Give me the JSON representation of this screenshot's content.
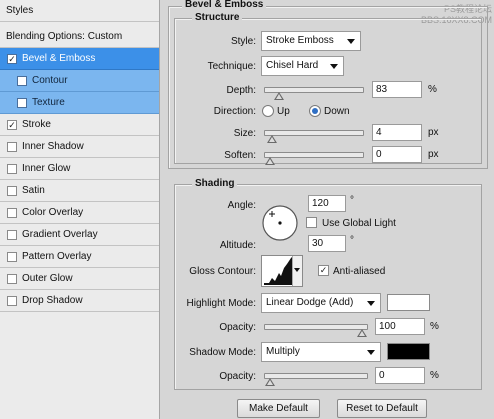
{
  "left_panel": {
    "header": "Styles",
    "blending": "Blending Options: Custom",
    "items": [
      {
        "label": "Bevel & Emboss",
        "checked": true
      },
      {
        "label": "Contour",
        "checked": false
      },
      {
        "label": "Texture",
        "checked": false
      },
      {
        "label": "Stroke",
        "checked": true
      },
      {
        "label": "Inner Shadow",
        "checked": false
      },
      {
        "label": "Inner Glow",
        "checked": false
      },
      {
        "label": "Satin",
        "checked": false
      },
      {
        "label": "Color Overlay",
        "checked": false
      },
      {
        "label": "Gradient Overlay",
        "checked": false
      },
      {
        "label": "Pattern Overlay",
        "checked": false
      },
      {
        "label": "Outer Glow",
        "checked": false
      },
      {
        "label": "Drop Shadow",
        "checked": false
      }
    ],
    "check_glyph": "✓"
  },
  "watermark": {
    "line1": "PS教程论坛",
    "line2": "BBS.16XX8.COM"
  },
  "bevel": {
    "section_title": "Bevel & Emboss",
    "structure_title": "Structure",
    "style_label": "Style:",
    "style_value": "Stroke Emboss",
    "technique_label": "Technique:",
    "technique_value": "Chisel Hard",
    "depth_label": "Depth:",
    "depth_value": "83",
    "depth_unit": "%",
    "depth_level": 0.1,
    "direction_label": "Direction:",
    "dir_up": "Up",
    "dir_down": "Down",
    "direction_selected": "Down",
    "size_label": "Size:",
    "size_value": "4",
    "size_unit": "px",
    "size_level": 0.02,
    "soften_label": "Soften:",
    "soften_value": "0",
    "soften_unit": "px",
    "soften_level": 0.0
  },
  "shading": {
    "title": "Shading",
    "angle_label": "Angle:",
    "angle_value": "120",
    "angle_unit": "°",
    "use_global_light": "Use Global Light",
    "use_global_light_checked": false,
    "altitude_label": "Altitude:",
    "altitude_value": "30",
    "altitude_unit": "°",
    "gloss_label": "Gloss Contour:",
    "anti_aliased": "Anti-aliased",
    "anti_aliased_checked": true,
    "highlight_label": "Highlight Mode:",
    "highlight_value": "Linear Dodge (Add)",
    "highlight_color": "#ffffff",
    "highlight_opacity_label": "Opacity:",
    "highlight_opacity_value": "100",
    "highlight_opacity_unit": "%",
    "highlight_opacity_level": 1.0,
    "shadow_label": "Shadow Mode:",
    "shadow_value": "Multiply",
    "shadow_color": "#000000",
    "shadow_opacity_label": "Opacity:",
    "shadow_opacity_value": "0",
    "shadow_opacity_unit": "%",
    "shadow_opacity_level": 0.0
  },
  "buttons": {
    "make_default": "Make Default",
    "reset_default": "Reset to Default"
  }
}
